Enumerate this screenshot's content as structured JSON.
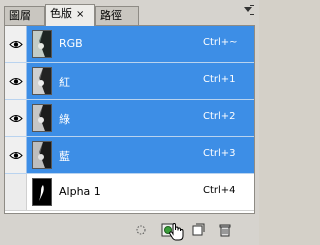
{
  "tabs": [
    {
      "label": "圖層",
      "active": false
    },
    {
      "label": "色版",
      "active": true,
      "close": "×"
    },
    {
      "label": "路徑",
      "active": false
    }
  ],
  "channels": [
    {
      "name": "RGB",
      "shortcut": "Ctrl+~",
      "visible": true,
      "selected": true,
      "thumb": "light"
    },
    {
      "name": "紅",
      "shortcut": "Ctrl+1",
      "visible": true,
      "selected": true,
      "thumb": "light"
    },
    {
      "name": "綠",
      "shortcut": "Ctrl+2",
      "visible": true,
      "selected": true,
      "thumb": "light"
    },
    {
      "name": "藍",
      "shortcut": "Ctrl+3",
      "visible": true,
      "selected": true,
      "thumb": "light"
    },
    {
      "name": "Alpha 1",
      "shortcut": "Ctrl+4",
      "visible": false,
      "selected": false,
      "thumb": "dark"
    }
  ],
  "toolbar": {
    "buttons": [
      "load-selection-icon",
      "save-selection-icon",
      "new-channel-icon",
      "trash-icon"
    ]
  },
  "colors": {
    "selection": "#3d8ee6",
    "panel": "#d6d3ce"
  }
}
